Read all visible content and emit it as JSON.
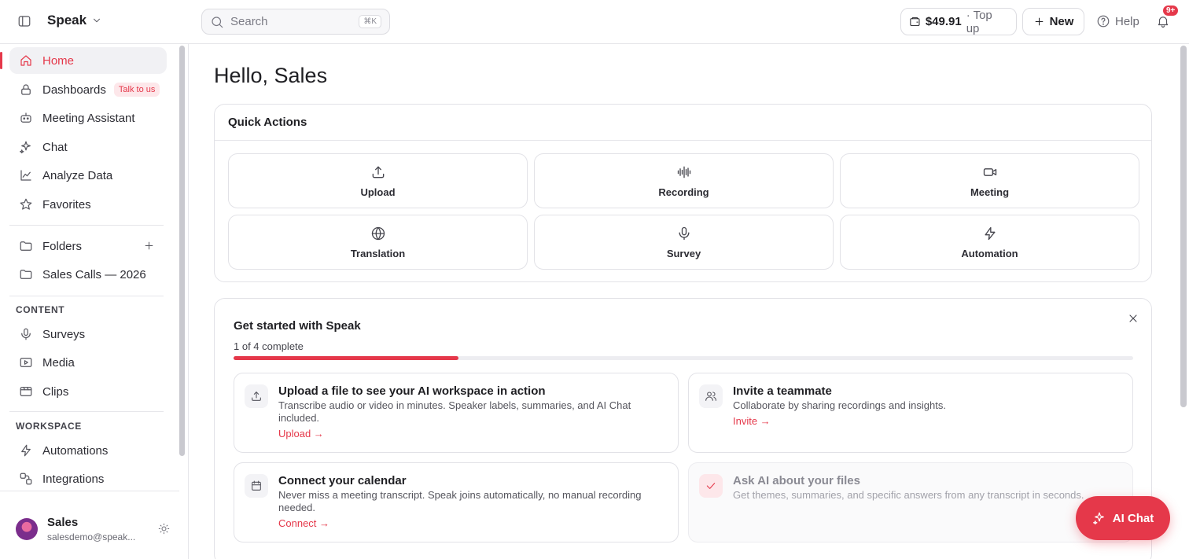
{
  "brand": {
    "name": "Speak"
  },
  "search": {
    "placeholder": "Search",
    "shortcut": "⌘K"
  },
  "header": {
    "credit_amount": "$49.91",
    "credit_action": "· Top up",
    "new_label": "New",
    "help_label": "Help",
    "notifications_badge": "9+"
  },
  "sidebar": {
    "items": [
      {
        "label": "Home",
        "icon": "home-icon",
        "active": true
      },
      {
        "label": "Dashboards",
        "icon": "lock-icon",
        "pill": "Talk to us"
      },
      {
        "label": "Meeting Assistant",
        "icon": "bot-icon"
      },
      {
        "label": "Chat",
        "icon": "sparkle-icon"
      },
      {
        "label": "Analyze Data",
        "icon": "chart-icon"
      },
      {
        "label": "Favorites",
        "icon": "star-icon"
      }
    ],
    "folders_label": "Folders",
    "folder_items": [
      {
        "label": "Sales Calls — 2026"
      }
    ],
    "content_header": "CONTENT",
    "content_items": [
      {
        "label": "Surveys"
      },
      {
        "label": "Media"
      },
      {
        "label": "Clips"
      }
    ],
    "workspace_header": "WORKSPACE",
    "workspace_items": [
      {
        "label": "Automations"
      },
      {
        "label": "Integrations"
      }
    ],
    "user": {
      "name": "Sales",
      "email": "salesdemo@speak..."
    }
  },
  "main": {
    "greeting": "Hello, Sales",
    "quick_actions": {
      "title": "Quick Actions",
      "cards": [
        {
          "label": "Upload",
          "icon": "upload-icon"
        },
        {
          "label": "Recording",
          "icon": "waveform-icon"
        },
        {
          "label": "Meeting",
          "icon": "video-icon"
        },
        {
          "label": "Translation",
          "icon": "globe-icon"
        },
        {
          "label": "Survey",
          "icon": "mic-icon"
        },
        {
          "label": "Automation",
          "icon": "bolt-icon"
        }
      ]
    },
    "get_started": {
      "title": "Get started with Speak",
      "progress_label": "1 of 4 complete",
      "progress_fraction": 0.25,
      "tasks": [
        {
          "title": "Upload a file to see your AI workspace in action",
          "desc": "Transcribe audio or video in minutes. Speaker labels, summaries, and AI Chat included.",
          "link": "Upload →",
          "icon": "upload-icon",
          "done": false
        },
        {
          "title": "Invite a teammate",
          "desc": "Collaborate by sharing recordings and insights.",
          "link": "Invite →",
          "icon": "users-icon",
          "done": false
        },
        {
          "title": "Connect your calendar",
          "desc": "Never miss a meeting transcript. Speak joins automatically, no manual recording needed.",
          "link": "Connect →",
          "icon": "calendar-icon",
          "done": false
        },
        {
          "title": "Ask AI about your files",
          "desc": "Get themes, summaries, and specific answers from any transcript in seconds.",
          "link": "",
          "icon": "check-icon",
          "done": true
        }
      ]
    }
  },
  "ai_chat": {
    "label": "AI Chat"
  },
  "colors": {
    "accent": "#e5384a",
    "border": "#e2e2e7",
    "muted": "#55555d"
  }
}
